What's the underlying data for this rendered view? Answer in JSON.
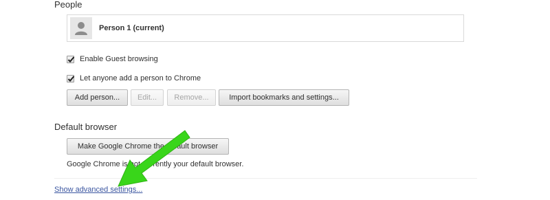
{
  "people": {
    "title": "People",
    "profiles": [
      {
        "name": "Person 1 (current)",
        "icon": "person-silhouette-icon"
      }
    ],
    "checkboxes": [
      {
        "label": "Enable Guest browsing",
        "checked": true
      },
      {
        "label": "Let anyone add a person to Chrome",
        "checked": true
      }
    ],
    "buttons": {
      "add": "Add person...",
      "edit": "Edit...",
      "remove": "Remove...",
      "import": "Import bookmarks and settings..."
    }
  },
  "default_browser": {
    "title": "Default browser",
    "button": "Make Google Chrome the default browser",
    "status": "Google Chrome is not currently your default browser."
  },
  "advanced_link": "Show advanced settings...",
  "colors": {
    "arrow": "#39d61a",
    "link": "#3a55a0"
  }
}
